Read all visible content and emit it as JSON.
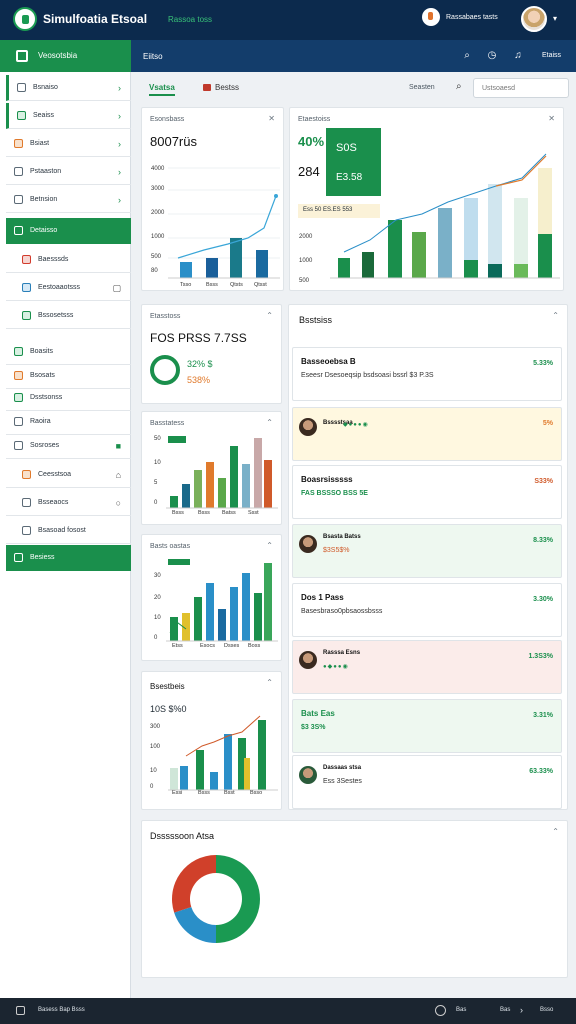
{
  "header": {
    "title": "Simulfoatia Etsoal",
    "subtitle": "Rassoa toss",
    "user_name": "Rassabaes tasts"
  },
  "secbar": {
    "brand": "Veosotsbia",
    "breadcrumb": "Eiitso",
    "more": "Etaiss"
  },
  "sidebar": {
    "items": [
      {
        "label": "Bsnaiso",
        "icon": "home-icon"
      },
      {
        "label": "Seaiss",
        "icon": "chart-icon"
      },
      {
        "label": "Bsiast",
        "icon": "globe-icon"
      },
      {
        "label": "Pstaaston",
        "icon": "search-icon"
      },
      {
        "label": "Betnsion",
        "icon": "camera-icon"
      },
      {
        "label": "Detaisso",
        "icon": "folder-icon"
      },
      {
        "label": "Baesssds",
        "icon": "calendar-icon"
      },
      {
        "label": "Eestoaaotsss",
        "icon": "image-icon"
      },
      {
        "label": "Bssosetsss",
        "icon": "flag-icon"
      },
      {
        "label": "Boasits",
        "icon": "bar-chart-icon"
      },
      {
        "label": "Bsosats",
        "icon": "list-icon"
      },
      {
        "label": "Dsstsonss",
        "icon": "cloud-icon"
      },
      {
        "label": "Raoira",
        "icon": "bulb-icon"
      },
      {
        "label": "Sosroses",
        "icon": "gear-icon"
      },
      {
        "label": "Ceesstsoa",
        "icon": "person-icon"
      },
      {
        "label": "Bsseaocs",
        "icon": "lock-icon"
      },
      {
        "label": "Bsasoad fosost",
        "icon": "doc-icon"
      },
      {
        "label": "Besiess",
        "icon": "exit-icon"
      }
    ]
  },
  "tabs": {
    "tab1": "Vsatsa",
    "tab2": "Bestss",
    "search_label": "Seasten",
    "search_placeholder": "Ustsoaesd"
  },
  "card_main": {
    "title": "Esonsbass",
    "value": "8007rüs",
    "yticks": [
      "4000",
      "3000",
      "2000",
      "1000",
      "500",
      "80"
    ],
    "xticks": [
      "Tsso",
      "Bsss",
      "Qtsts",
      "Qtsst"
    ]
  },
  "card_kpi": {
    "title": "Etaestoiss",
    "pct": "40%",
    "val": "284",
    "green_title": "S0S",
    "green_sub": "E3.58",
    "tag": "Ess 50 ES.ES 553",
    "yticks": [
      "2000",
      "1000",
      "500"
    ]
  },
  "card_mini1": {
    "title": "Etasstoss",
    "value": "FOS PRSS 7.7SS",
    "p1": "32% $",
    "p2": "538%"
  },
  "card_mini2": {
    "title": "Basstatess",
    "ytick": [
      "50",
      "10",
      "5",
      "0"
    ],
    "xticks": [
      "Bsss",
      "Bsss",
      "Batss",
      "Ssst"
    ]
  },
  "card_mini3": {
    "title": "Basts oastas",
    "ytick": [
      "30",
      "20",
      "10",
      "0"
    ],
    "xticks": [
      "Etss",
      "Esocs",
      "Dsses",
      "Boss"
    ]
  },
  "card_mini4": {
    "title": "Bsestbeis",
    "value": "10S $%0",
    "ytick": [
      "300",
      "100",
      "10",
      "0"
    ],
    "xticks": [
      "Essi",
      "Bsss",
      "Bsst",
      "Bsso"
    ]
  },
  "feed": {
    "title": "Bsstsiss",
    "items": [
      {
        "title": "Basseoebsa B",
        "sub": "Eseesr Dsesoeqsip bsdsoasi bssrl $3 P.3S",
        "val": "5.33%"
      },
      {
        "title": "Bsssstsaa",
        "sub": "",
        "val": "5%"
      },
      {
        "title": "Boasrsisssss",
        "sub": "FAS BSSSO BSS 5E",
        "val": "S33%"
      },
      {
        "title": "Bsasta Batss",
        "sub": "$3S5$%",
        "val": "8.33%"
      },
      {
        "title": "Dos 1 Pass",
        "sub": "Basesbraso0pbsaossbsss",
        "val": "3.30%"
      },
      {
        "title": "Rasssa Esns",
        "sub": "",
        "val": "1.3S3%"
      },
      {
        "title": "Bats Eas",
        "sub": "$3 3S%",
        "val": "3.31%"
      },
      {
        "title": "Dassaas stsa",
        "sub": "Ess 3Sestes",
        "val": "63.33%"
      }
    ]
  },
  "donut": {
    "title": "Dsssssoon Atsa",
    "slices": [
      {
        "label": "green",
        "value": 50,
        "color": "#1a9a52"
      },
      {
        "label": "blue",
        "value": 20,
        "color": "#2a8fc8"
      },
      {
        "label": "red",
        "value": 30,
        "color": "#d0402a"
      }
    ]
  },
  "footer": {
    "left": "Basess Bap Bsss",
    "right1": "Bas",
    "right2": "Bsso"
  },
  "chart_data": [
    {
      "type": "bar",
      "categories": [
        "Tsso",
        "Bsss",
        "Qtsts",
        "Qtsst"
      ],
      "values": [
        400,
        500,
        1100,
        800
      ],
      "series": [
        {
          "name": "",
          "values": [
            1000,
            1800,
            2400,
            3200
          ]
        }
      ],
      "ylim": [
        0,
        4000
      ]
    },
    {
      "type": "bar",
      "series": [
        {
          "name": "",
          "values": [
            400,
            800,
            1500,
            200,
            1700,
            300,
            600
          ]
        }
      ]
    },
    {
      "type": "bar",
      "categories": [
        "Bsss",
        "Bsss",
        "Batss",
        "Ssst"
      ],
      "series": [
        {
          "name": "",
          "values": [
            10,
            12,
            20,
            40,
            30,
            45,
            50,
            45
          ]
        }
      ]
    },
    {
      "type": "bar",
      "categories": [
        "Etss",
        "Esocs",
        "Dsses",
        "Boss"
      ],
      "series": [
        {
          "name": "",
          "values": [
            5,
            10,
            22,
            18,
            26,
            20,
            30,
            22
          ]
        }
      ]
    },
    {
      "type": "bar",
      "categories": [
        "Essi",
        "Bsss",
        "Bsst",
        "Bsso"
      ],
      "series": [
        {
          "name": "",
          "values": [
            100,
            120,
            150,
            60,
            200,
            180,
            250
          ]
        }
      ]
    },
    {
      "type": "pie",
      "categories": [
        "green",
        "blue",
        "red"
      ],
      "values": [
        50,
        20,
        30
      ]
    }
  ]
}
